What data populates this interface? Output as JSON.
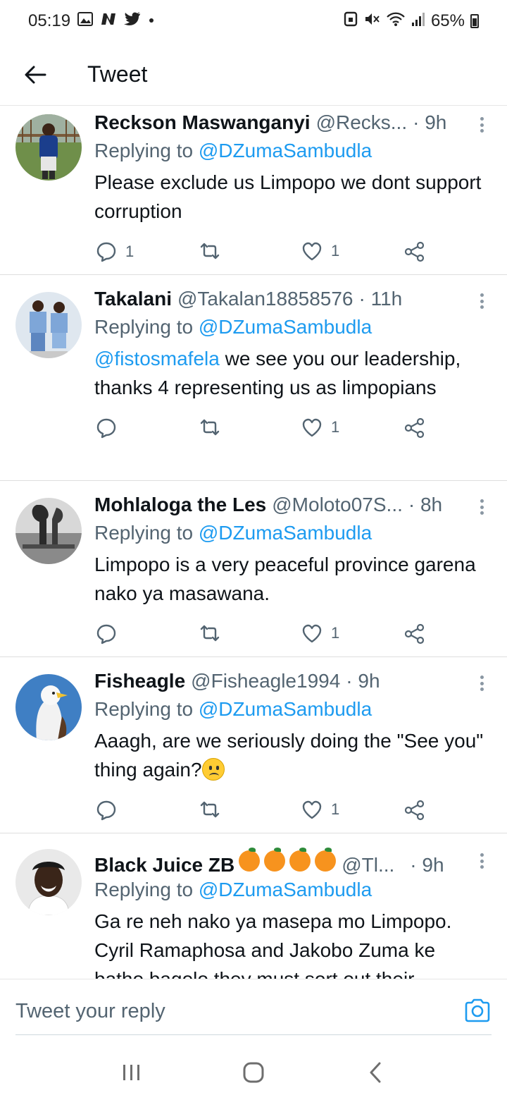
{
  "status_bar": {
    "time": "05:19",
    "battery": "65%",
    "left_icons": [
      "gallery-icon",
      "n-icon",
      "twitter-icon",
      "dot-icon"
    ],
    "right_icons": [
      "lock-icon",
      "mute-icon",
      "wifi-icon",
      "signal-icon",
      "battery-icon"
    ]
  },
  "header": {
    "title": "Tweet",
    "back_icon": "arrow-left-icon"
  },
  "tweets": [
    {
      "author": "Reckson Maswanganyi",
      "handle": "@Recks...",
      "time": "· 9h",
      "replying_prefix": "Replying to ",
      "replying_to": "@DZumaSambudla",
      "text": "Please exclude us Limpopo we dont support corruption",
      "reply_count": "1",
      "retweet_count": "",
      "like_count": "1"
    },
    {
      "author": "Takalani",
      "handle": "@Takalan18858576",
      "time": "· 11h",
      "replying_prefix": "Replying to ",
      "replying_to": "@DZumaSambudla",
      "text_mention": "@fistosmafela",
      "text": " we see you our leadership,  thanks 4 representing us as limpopians",
      "reply_count": "",
      "retweet_count": "",
      "like_count": "1"
    },
    {
      "author": "Mohlaloga the Les",
      "handle": "@Moloto07S...",
      "time": "· 8h",
      "replying_prefix": "Replying to ",
      "replying_to": "@DZumaSambudla",
      "text": "Limpopo is a very peaceful province garena nako ya masawana.",
      "reply_count": "",
      "retweet_count": "",
      "like_count": "1"
    },
    {
      "author": "Fisheagle",
      "handle": "@Fisheagle1994",
      "time": "· 9h",
      "replying_prefix": "Replying to ",
      "replying_to": "@DZumaSambudla",
      "text": "Aaagh, are we seriously doing the \"See you\" thing again?",
      "emoji": "frowning-face",
      "reply_count": "",
      "retweet_count": "",
      "like_count": "1"
    },
    {
      "author": "Black Juice ZB",
      "author_emojis": [
        "orange",
        "orange",
        "orange",
        "orange"
      ],
      "handle": "@Tl...",
      "time": "· 9h",
      "replying_prefix": "Replying to ",
      "replying_to": "@DZumaSambudla",
      "text": "Ga re neh nako ya masepa mo Limpopo. Cyril Ramaphosa and Jakobo Zuma ke batho bagolo they must sort out their"
    }
  ],
  "reply_bar": {
    "placeholder": "Tweet your reply",
    "camera_icon": "camera-icon"
  },
  "nav_bar": {
    "icons": [
      "recent-apps-icon",
      "home-icon",
      "back-icon"
    ]
  },
  "colors": {
    "accent": "#1d9bf0",
    "secondary_text": "#536471",
    "primary_text": "#0f1419"
  }
}
